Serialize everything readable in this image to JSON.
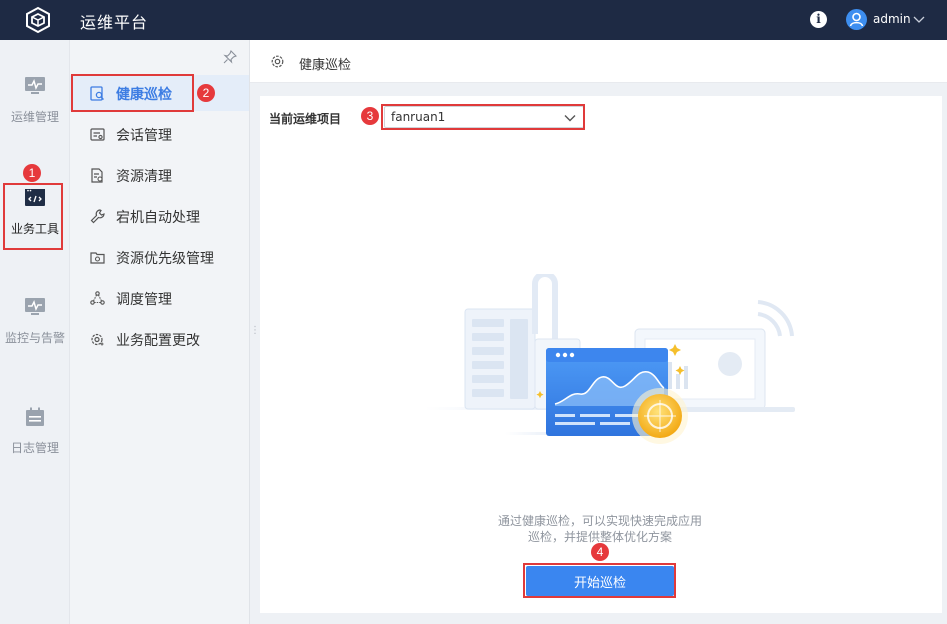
{
  "app": {
    "title": "运维平台"
  },
  "user": {
    "name": "admin"
  },
  "rail": {
    "items": [
      {
        "label": "运维管理",
        "icon": "monitor-icon"
      },
      {
        "label": "业务工具",
        "icon": "code-window-icon",
        "active": true
      },
      {
        "label": "监控与告警",
        "icon": "alarm-monitor-icon"
      },
      {
        "label": "日志管理",
        "icon": "calendar-log-icon"
      }
    ]
  },
  "submenu": {
    "items": [
      {
        "label": "健康巡检",
        "icon": "health-check-icon",
        "active": true
      },
      {
        "label": "会话管理",
        "icon": "session-icon"
      },
      {
        "label": "资源清理",
        "icon": "resource-clean-icon"
      },
      {
        "label": "宕机自动处理",
        "icon": "wrench-icon"
      },
      {
        "label": "资源优先级管理",
        "icon": "priority-icon"
      },
      {
        "label": "调度管理",
        "icon": "schedule-icon"
      },
      {
        "label": "业务配置更改",
        "icon": "config-gear-icon"
      }
    ]
  },
  "header": {
    "title": "健康巡检"
  },
  "main": {
    "project_label": "当前运维项目",
    "project_value": "fanruan1",
    "hint_line1": "通过健康巡检，可以实现快速完成应用",
    "hint_line2": "巡检，并提供整体优化方案",
    "start_button": "开始巡检"
  },
  "annotations": {
    "b1": "1",
    "b2": "2",
    "b3": "3",
    "b4": "4"
  },
  "colors": {
    "topbar": "#1e2a44",
    "accent": "#3a86f0",
    "active_text": "#3d7de3",
    "annotation": "#e03a3a"
  }
}
